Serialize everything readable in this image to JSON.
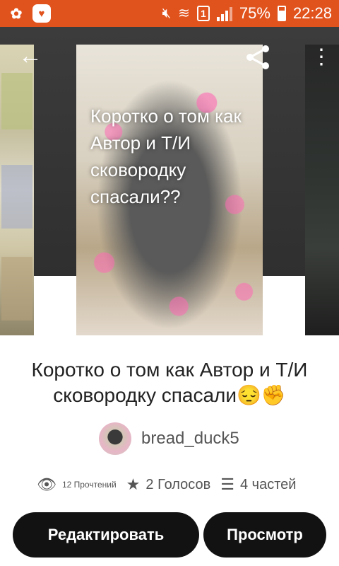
{
  "status_bar": {
    "battery": "75%",
    "time": "22:28",
    "sim": "1"
  },
  "cover": {
    "text": "Коротко о том как Автор и Т/И сковородку спасали??"
  },
  "story": {
    "title": "Коротко о том как Автор и Т/И сковородку спасали😔✊",
    "author": "bread_duck5",
    "reads": "12 Прочтений",
    "votes": "2 Голосов",
    "parts": "4 частей"
  },
  "actions": {
    "edit_label": "Редактировать",
    "view_label": "Просмотр"
  },
  "colors": {
    "status_bar": "#e1531d",
    "button": "#121212"
  }
}
